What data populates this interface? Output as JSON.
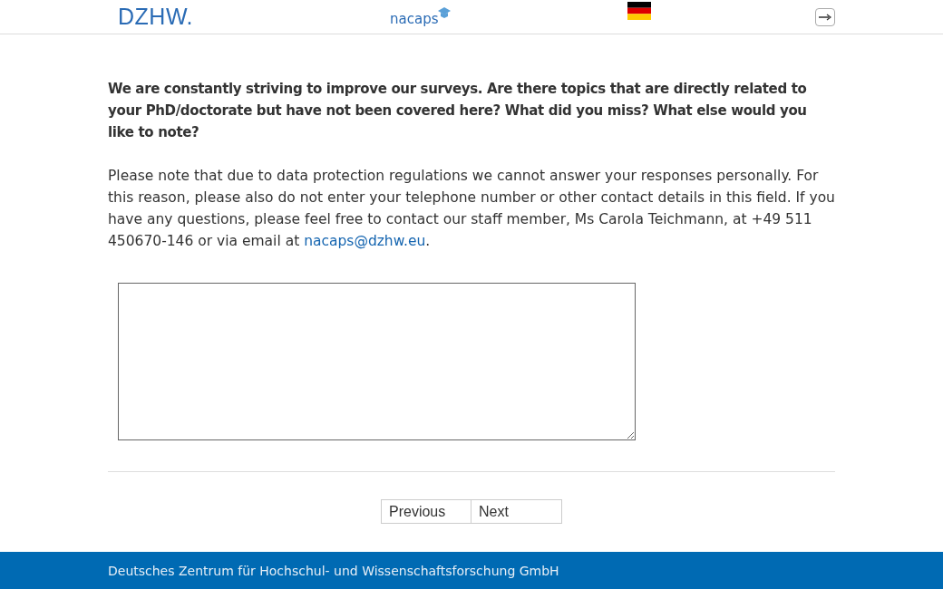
{
  "header": {
    "logo": "DZHW.",
    "brand": "nacaps"
  },
  "question": "We are constantly striving to improve our surveys. Are there topics that are directly related to your PhD/doctorate but have not been covered here? What did you miss? What else would you like to note?",
  "note": {
    "text": "Please note that due to data protection regulations we cannot answer your responses personally. For this reason, please also do not enter your telephone number or other contact details in this field. If you have any questions, please feel free to contact our staff member, Ms Carola Teichmann, at +49 511 450670-146 or via email at ",
    "link": "nacaps@dzhw.eu",
    "after": "."
  },
  "buttons": [
    "Previous",
    "Next"
  ],
  "footer": "Deutsches Zentrum für Hochschul- und Wissenschaftsforschung GmbH"
}
